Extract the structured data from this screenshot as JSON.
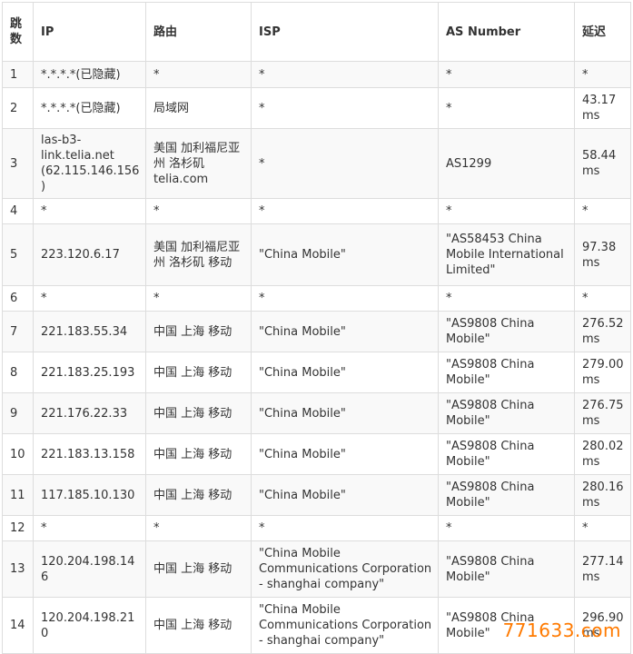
{
  "table": {
    "headers": {
      "hop": "跳数",
      "ip": "IP",
      "route": "路由",
      "isp": "ISP",
      "as_number": "AS Number",
      "latency": "延迟"
    },
    "rows": [
      {
        "hop": "1",
        "ip": "*.*.*.*(已隐藏)",
        "route": "*",
        "isp": "*",
        "as_number": "*",
        "latency": "*"
      },
      {
        "hop": "2",
        "ip": "*.*.*.*(已隐藏)",
        "route": "局域网",
        "isp": "*",
        "as_number": "*",
        "latency": "43.17 ms"
      },
      {
        "hop": "3",
        "ip": "las-b3-link.telia.net (62.115.146.156)",
        "route": "美国 加利福尼亚州 洛杉矶 telia.com",
        "isp": "*",
        "as_number": "AS1299",
        "latency": "58.44 ms"
      },
      {
        "hop": "4",
        "ip": "*",
        "route": "*",
        "isp": "*",
        "as_number": "*",
        "latency": "*"
      },
      {
        "hop": "5",
        "ip": "223.120.6.17",
        "route": "美国 加利福尼亚州 洛杉矶 移动",
        "isp": "\"China Mobile\"",
        "as_number": "\"AS58453 China Mobile International Limited\"",
        "latency": "97.38 ms"
      },
      {
        "hop": "6",
        "ip": "*",
        "route": "*",
        "isp": "*",
        "as_number": "*",
        "latency": "*"
      },
      {
        "hop": "7",
        "ip": "221.183.55.34",
        "route": "中国 上海 移动",
        "isp": "\"China Mobile\"",
        "as_number": "\"AS9808 China Mobile\"",
        "latency": "276.52 ms"
      },
      {
        "hop": "8",
        "ip": "221.183.25.193",
        "route": "中国 上海 移动",
        "isp": "\"China Mobile\"",
        "as_number": "\"AS9808 China Mobile\"",
        "latency": "279.00 ms"
      },
      {
        "hop": "9",
        "ip": "221.176.22.33",
        "route": "中国 上海 移动",
        "isp": "\"China Mobile\"",
        "as_number": "\"AS9808 China Mobile\"",
        "latency": "276.75 ms"
      },
      {
        "hop": "10",
        "ip": "221.183.13.158",
        "route": "中国 上海 移动",
        "isp": "\"China Mobile\"",
        "as_number": "\"AS9808 China Mobile\"",
        "latency": "280.02 ms"
      },
      {
        "hop": "11",
        "ip": "117.185.10.130",
        "route": "中国 上海 移动",
        "isp": "\"China Mobile\"",
        "as_number": "\"AS9808 China Mobile\"",
        "latency": "280.16 ms"
      },
      {
        "hop": "12",
        "ip": "*",
        "route": "*",
        "isp": "*",
        "as_number": "*",
        "latency": "*"
      },
      {
        "hop": "13",
        "ip": "120.204.198.146",
        "route": "中国 上海 移动",
        "isp": "\"China Mobile Communications Corporation - shanghai company\"",
        "as_number": "\"AS9808 China Mobile\"",
        "latency": "277.14 ms"
      },
      {
        "hop": "14",
        "ip": "120.204.198.210",
        "route": "中国 上海 移动",
        "isp": "\"China Mobile Communications Corporation - shanghai company\"",
        "as_number": "\"AS9808 China Mobile\"",
        "latency": "296.90 ms"
      }
    ]
  },
  "watermark": "771633.com",
  "colors": {
    "border": "#dddddd",
    "stripe": "#f9f9f9",
    "text": "#333333",
    "watermark": "#ff7a00"
  }
}
